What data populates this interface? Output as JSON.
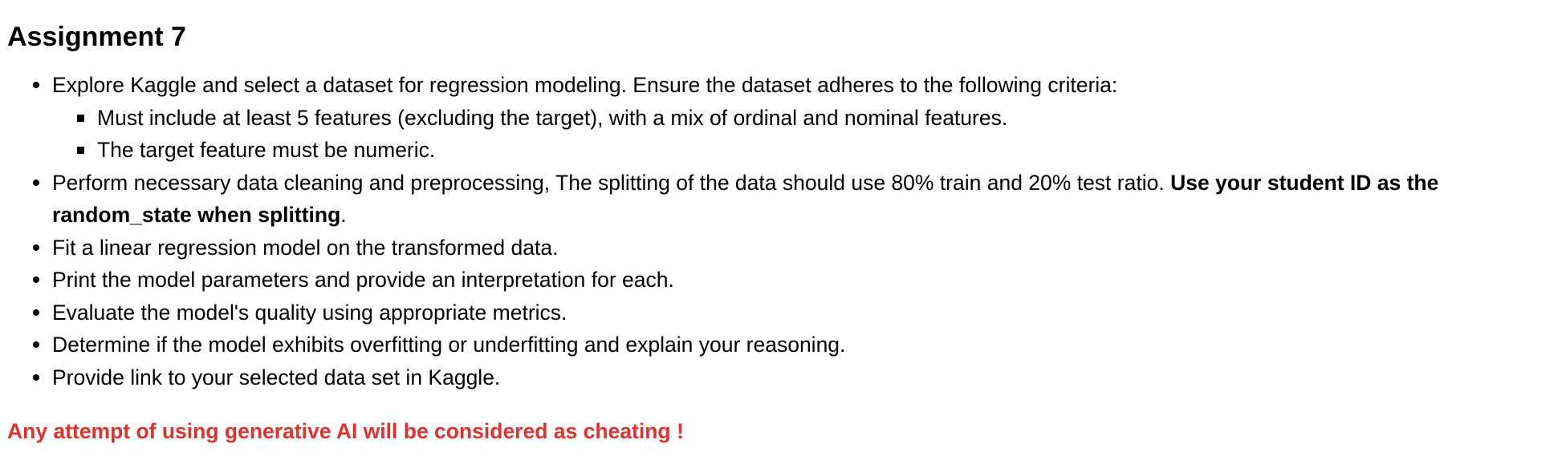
{
  "title": "Assignment 7",
  "items": [
    {
      "text": "Explore Kaggle and select a dataset for regression modeling. Ensure the dataset adheres to the following criteria:",
      "subitems": [
        "Must include at least 5 features (excluding the target), with a mix of ordinal and nominal features.",
        "The target feature must be numeric."
      ]
    },
    {
      "text": "Perform necessary data cleaning and preprocessing, The splitting of the data should use 80% train and 20% test ratio. ",
      "bold": "Use your student ID as the random_state when splitting",
      "tail": "."
    },
    {
      "text": "Fit a linear regression model on the transformed data."
    },
    {
      "text": "Print the model parameters and provide an interpretation for each."
    },
    {
      "text": "Evaluate the model's quality using appropriate metrics."
    },
    {
      "text": "Determine if the model exhibits overfitting or underfitting and explain your reasoning."
    },
    {
      "text": "Provide link to your selected data set in Kaggle."
    }
  ],
  "warning": "Any attempt of using generative AI will be considered as cheating !",
  "colors": {
    "text": "#000000",
    "warning": "#e2302a",
    "background": "#ffffff"
  }
}
